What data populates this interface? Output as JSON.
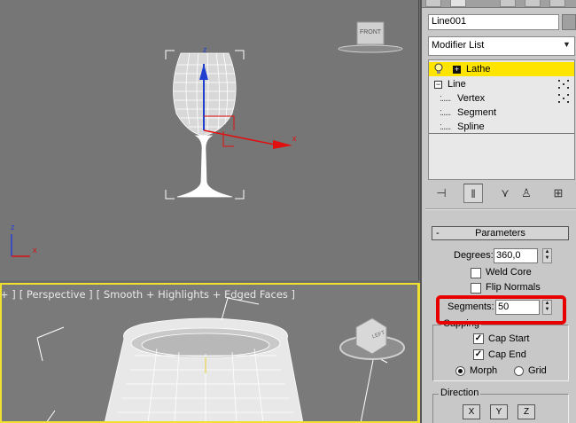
{
  "viewport_top": {
    "view_cube_label": "FRONT",
    "gizmo_axes": {
      "z": "z",
      "x": "x"
    },
    "world_axes": {
      "z": "z",
      "x": "x"
    }
  },
  "viewport_bottom": {
    "labels": [
      "+ ]",
      "[ Perspective ]",
      "[ Smooth + Highlights + Edged Faces ]"
    ],
    "view_cube_label": "LEFT"
  },
  "panel": {
    "object_name": "Line001",
    "modifier_list": "Modifier List",
    "stack": {
      "lathe": "Lathe",
      "line": "Line",
      "sub": [
        "Vertex",
        "Segment",
        "Spline"
      ]
    },
    "rollout_title": "Parameters",
    "degrees_label": "Degrees:",
    "degrees_value": "360,0",
    "weld_core": "Weld Core",
    "flip_normals": "Flip Normals",
    "segments_label": "Segments:",
    "segments_value": "50",
    "capping_title": "Capping",
    "cap_start": "Cap Start",
    "cap_end": "Cap End",
    "morph": "Morph",
    "grid": "Grid",
    "direction_title": "Direction",
    "dir_x": "X",
    "dir_y": "Y",
    "dir_z": "Z"
  },
  "colors": {
    "active_viewport_border": "#f0e030",
    "selected_modifier": "#ffe400",
    "annotation_box": "#e80000",
    "gizmo_z": "#1f3fd0",
    "gizmo_x": "#e01010"
  },
  "states": {
    "weld_core": false,
    "flip_normals": false,
    "cap_start": true,
    "cap_end": true,
    "morph_selected": true
  }
}
